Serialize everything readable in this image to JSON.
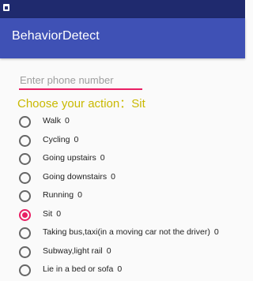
{
  "status_bar": {
    "icon": "notification-icon"
  },
  "app": {
    "title": "BehaviorDetect"
  },
  "phone": {
    "placeholder": "Enter phone number",
    "value": ""
  },
  "action": {
    "prefix": "Choose your action：",
    "selected": "Sit"
  },
  "accent_color": "#e91e63",
  "primary_color": "#3f51b5",
  "options": [
    {
      "label": "Walk",
      "count": "0",
      "checked": false
    },
    {
      "label": "Cycling",
      "count": "0",
      "checked": false
    },
    {
      "label": "Going upstairs",
      "count": "0",
      "checked": false
    },
    {
      "label": "Going downstairs",
      "count": "0",
      "checked": false
    },
    {
      "label": "Running",
      "count": "0",
      "checked": false
    },
    {
      "label": "Sit",
      "count": "0",
      "checked": true
    },
    {
      "label": "Taking bus,taxi(in a moving car not the driver)",
      "count": "0",
      "checked": false
    },
    {
      "label": "Subway,light rail",
      "count": "0",
      "checked": false
    },
    {
      "label": "Lie in a bed or sofa",
      "count": "0",
      "checked": false
    }
  ]
}
